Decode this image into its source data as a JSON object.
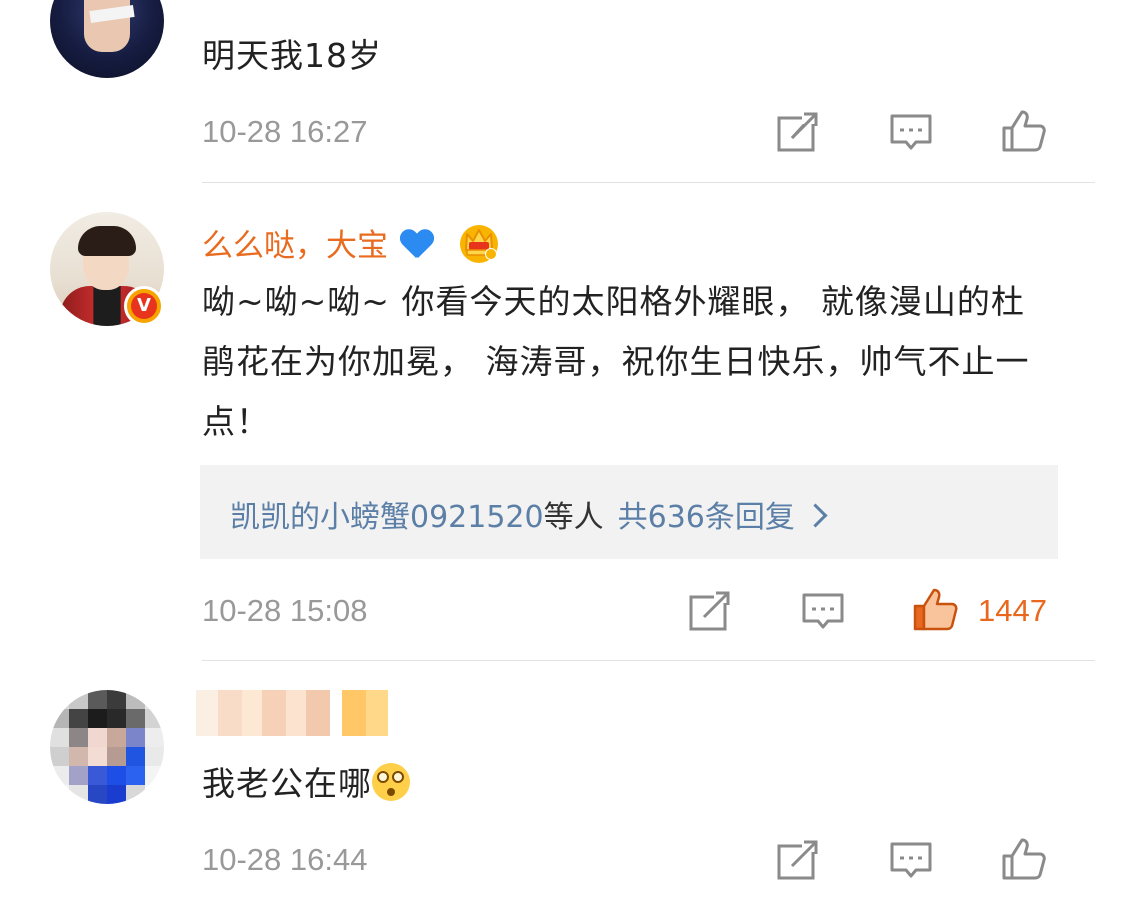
{
  "comments": [
    {
      "username": "",
      "text": "明天我18岁",
      "time": "10-28 16:27",
      "like_count": "",
      "liked": false
    },
    {
      "username": "么么哒，大宝",
      "verified": true,
      "badges": [
        "blue-heart-icon",
        "crown-icon"
      ],
      "text": "呦~呦~呦~ 你看今天的太阳格外耀眼， 就像漫山的杜鹃花在为你加冕， 海涛哥，祝你生日快乐，帅气不止一点！",
      "reply_preview": {
        "names": "凯凯的小螃蟹0921520",
        "names_suffix": "等人",
        "count_label": "共636条回复"
      },
      "time": "10-28 15:08",
      "like_count": "1447",
      "liked": true
    },
    {
      "username": "",
      "username_pixelated": true,
      "text": "我老公在哪",
      "emoji": "dizzy-face-icon",
      "time": "10-28 16:44",
      "like_count": "",
      "liked": false
    }
  ],
  "icons": {
    "repost": "repost-icon",
    "comment": "comment-icon",
    "like": "thumbs-up-icon"
  },
  "colors": {
    "username": "#e86b1f",
    "timestamp": "#999999",
    "like_active": "#e8681e",
    "reply_link": "#5b7fa6",
    "reply_bg": "#f2f2f2",
    "icon_stroke": "#8a8a8a"
  }
}
